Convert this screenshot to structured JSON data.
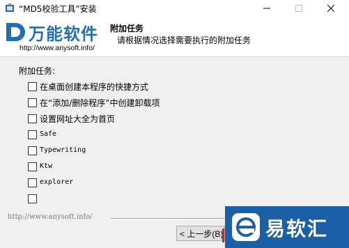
{
  "window": {
    "title": "“MD5校验工具”安装",
    "controls": [
      "minimize-icon",
      "maximize-icon",
      "close-icon"
    ]
  },
  "header": {
    "logo_text": "万能软件",
    "logo_url": "http://www.anysoft.info/",
    "title": "附加任务",
    "subtitle": "请根据情况选择需要执行的附加任务"
  },
  "tasks": {
    "group_label": "附加任务:",
    "items": [
      {
        "label": "在桌面创建本程序的快捷方式",
        "checked": false
      },
      {
        "label": "在“添加/删除程序”中创建卸载项",
        "checked": false
      },
      {
        "label": "设置网址大全为首页",
        "checked": false
      },
      {
        "label": "Safe",
        "checked": false
      },
      {
        "label": "Typewriting",
        "checked": false
      },
      {
        "label": "Ktw",
        "checked": false
      },
      {
        "label": "explorer",
        "checked": false
      },
      {
        "label": "",
        "checked": false
      }
    ]
  },
  "footer": {
    "separator_text": "http://www.anysoft.info/",
    "back_label": "< 上一步(B)"
  },
  "watermark": {
    "text": "易软汇"
  },
  "colors": {
    "brand_blue": "#1f6fb8",
    "watermark_bg": "#1b5fa6",
    "next_button_edge": "#e02020"
  }
}
